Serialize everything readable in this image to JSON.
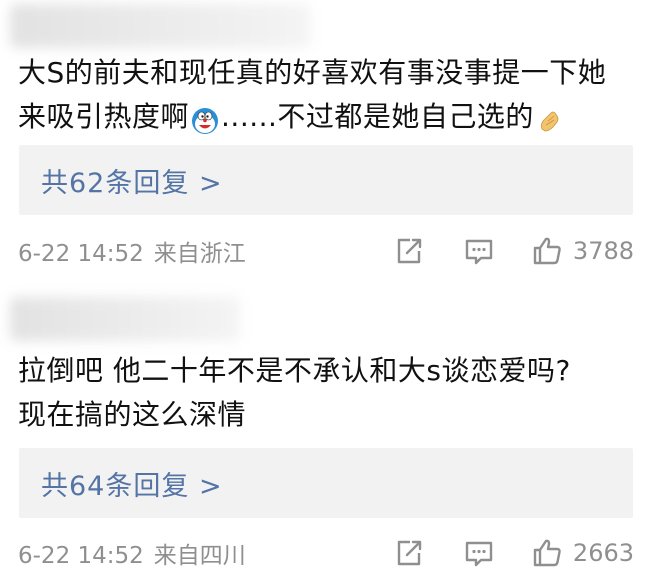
{
  "comments": [
    {
      "text_line1": "大S的前夫和现任真的好喜欢有事没事提一下她",
      "text_line2_a": "来吸引热度啊",
      "text_line2_b": "......不过都是她自己选的",
      "reply_link": "共62条回复 >",
      "date": "6-22 14:52",
      "source": "来自浙江",
      "likes": "3788"
    },
    {
      "text_line1": "拉倒吧 他二十年不是不承认和大s谈恋爱吗?",
      "text_line2": "现在搞的这么深情",
      "reply_link": "共64条回复 >",
      "date": "6-22 14:52",
      "source": "来自四川",
      "likes": "2663"
    }
  ],
  "icons": {
    "emoji_1": "doraemon-face-emoji",
    "emoji_2": "pinched-fingers-emoji",
    "share": "share-icon",
    "comment": "comment-icon",
    "like": "thumbs-up-icon"
  },
  "colors": {
    "link": "#5474a6",
    "meta": "#8f8f8f",
    "reply_bg": "#f2f2f2"
  }
}
